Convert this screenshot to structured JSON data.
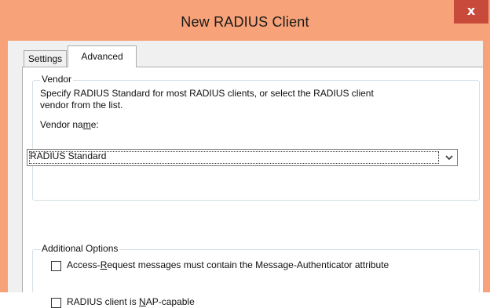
{
  "window": {
    "title": "New RADIUS Client",
    "close_glyph": "x",
    "accent_color": "#f7a278"
  },
  "tabs": [
    {
      "label": "Settings",
      "selected": false
    },
    {
      "label": "Advanced",
      "selected": true
    }
  ],
  "vendor": {
    "legend": "Vendor",
    "description_line1": "Specify RADIUS Standard for most RADIUS clients, or select the RADIUS client",
    "description_line2": "vendor from the list.",
    "name_label": "Vendor name:",
    "selected_value": "RADIUS Standard"
  },
  "additional_options": {
    "legend": "Additional Options",
    "options": [
      {
        "label": "Access-Request messages must contain the Message-Authenticator attribute",
        "checked": false
      },
      {
        "label": "RADIUS client is NAP-capable",
        "checked": false
      }
    ]
  },
  "icons": {
    "combo_arrow": "chevron-down-icon",
    "close": "close-icon"
  }
}
